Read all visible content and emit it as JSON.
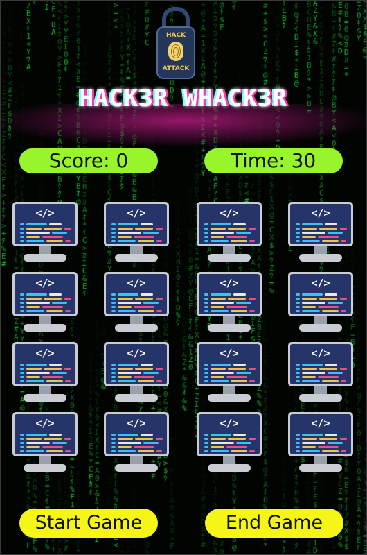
{
  "logo": {
    "top_text": "HACK",
    "bottom_text": "ATTACK"
  },
  "title": "HACK3R WHACK3R",
  "score": {
    "label": "Score: 0"
  },
  "time": {
    "label": "Time: 30"
  },
  "buttons": {
    "start": "Start Game",
    "end": "End Game"
  },
  "grid": {
    "rows": 4,
    "cols": 4,
    "screen_code": "</>",
    "icon": "computer-monitor-icon"
  },
  "colors": {
    "background": "#000000",
    "matrix_green": "#1fdc3a",
    "pill_green": "#99f52b",
    "button_yellow": "#f5f518",
    "title_glow": "#c8208c",
    "screen_blue": "#25356a",
    "code_line_colors": [
      "#3ec1f2",
      "#f0c24a",
      "#ef4e82",
      "#e8e8e8"
    ]
  }
}
